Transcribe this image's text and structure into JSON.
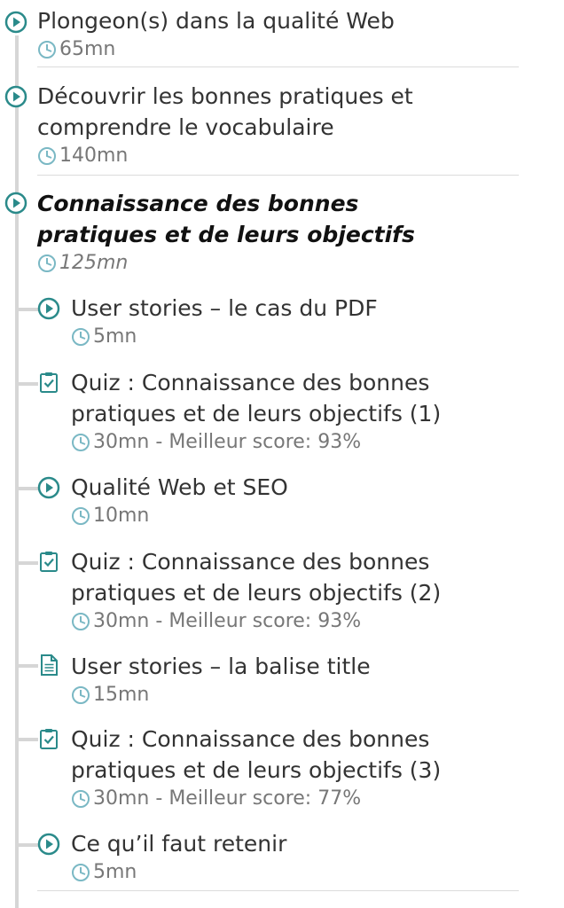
{
  "modules": [
    {
      "title": "Plongeon(s) dans la qualité Web",
      "duration": "65mn"
    },
    {
      "title": "Découvrir les bonnes pratiques et comprendre le vocabulaire",
      "duration": "140mn"
    },
    {
      "title": "Connaissance des bonnes pratiques et de leurs objectifs",
      "duration": "125mn"
    }
  ],
  "lessons": [
    {
      "type": "video",
      "title": "User stories – le cas du PDF",
      "duration": "5mn"
    },
    {
      "type": "quiz",
      "title": "Quiz : Connaissance des bonnes pratiques et de leurs objectifs (1)",
      "duration": "30mn",
      "score": "Meilleur score: 93%"
    },
    {
      "type": "video",
      "title": "Qualité Web et SEO",
      "duration": "10mn"
    },
    {
      "type": "quiz",
      "title": "Quiz : Connaissance des bonnes pratiques et de leurs objectifs (2)",
      "duration": "30mn",
      "score": "Meilleur score: 93%"
    },
    {
      "type": "document",
      "title": "User stories – la balise title",
      "duration": "15mn"
    },
    {
      "type": "quiz",
      "title": "Quiz : Connaissance des bonnes pratiques et de leurs objectifs (3)",
      "duration": "30mn",
      "score": "Meilleur score: 77%"
    },
    {
      "type": "video",
      "title": "Ce qu’il faut retenir",
      "duration": "5mn"
    }
  ],
  "score_separator": " - ",
  "colors": {
    "accent": "#2a8a8a",
    "rail": "#d6d6d6",
    "text": "#333333",
    "meta": "#777777"
  }
}
